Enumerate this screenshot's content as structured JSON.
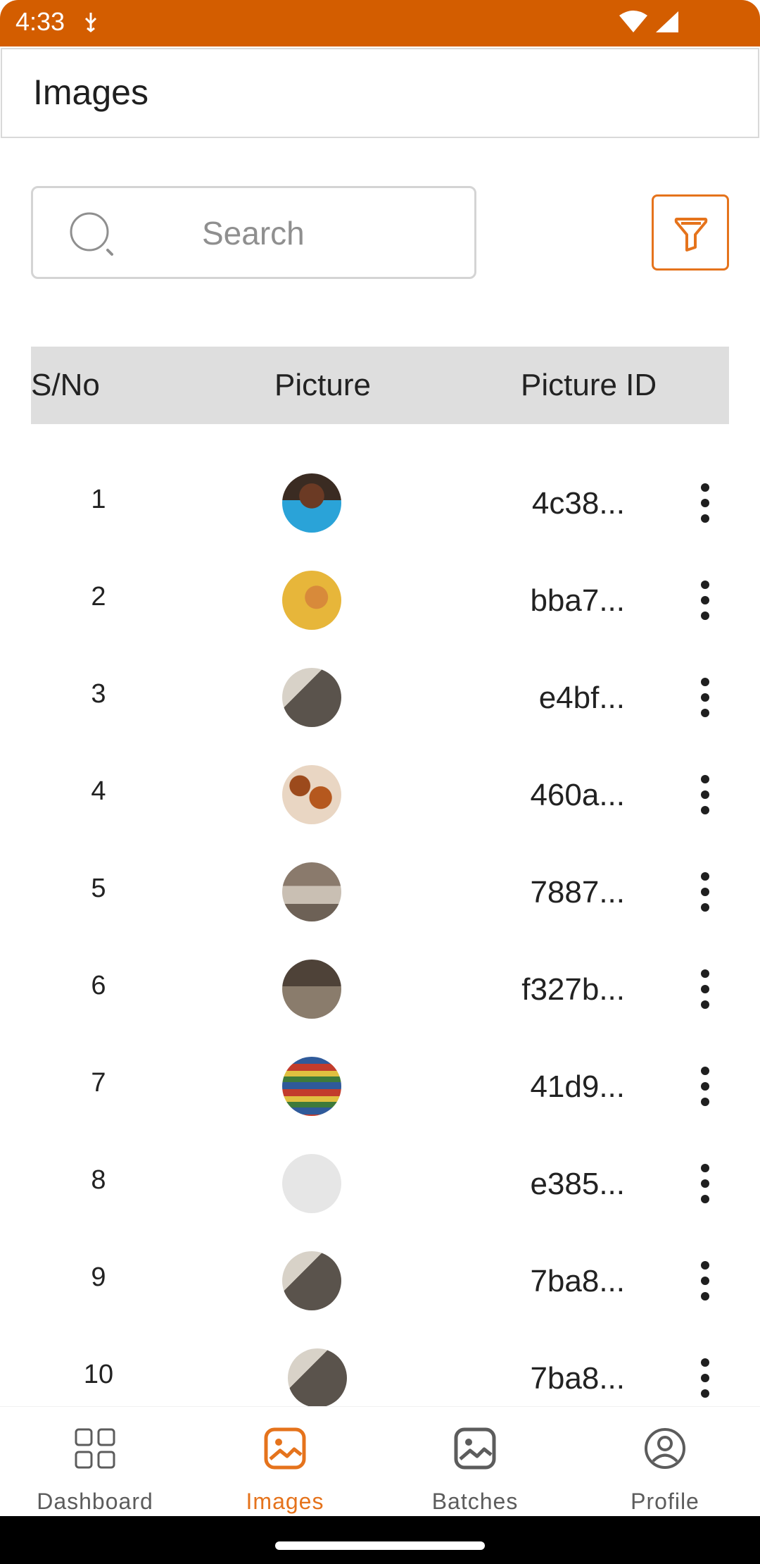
{
  "status": {
    "time": "4:33"
  },
  "header": {
    "title": "Images"
  },
  "search": {
    "placeholder": "Search"
  },
  "table": {
    "headers": [
      "S/No",
      "Picture",
      "Picture ID"
    ],
    "rows": [
      {
        "sno": "1",
        "id": "4c38...",
        "thumb": "child-portrait"
      },
      {
        "sno": "2",
        "id": "bba7...",
        "thumb": "cat"
      },
      {
        "sno": "3",
        "id": "e4bf...",
        "thumb": "room-checkerboard"
      },
      {
        "sno": "4",
        "id": "460a...",
        "thumb": "pretzels"
      },
      {
        "sno": "5",
        "id": "7887...",
        "thumb": "living-room"
      },
      {
        "sno": "6",
        "id": "f327b...",
        "thumb": "kitchen"
      },
      {
        "sno": "7",
        "id": "41d9...",
        "thumb": "store-shelves"
      },
      {
        "sno": "8",
        "id": "e385...",
        "thumb": "blank"
      },
      {
        "sno": "9",
        "id": "7ba8...",
        "thumb": "room-checkerboard"
      },
      {
        "sno": "10",
        "id": "7ba8...",
        "thumb": "room-checkerboard"
      }
    ]
  },
  "nav": {
    "items": [
      {
        "label": "Dashboard",
        "icon": "grid-icon",
        "active": false
      },
      {
        "label": "Images",
        "icon": "image-icon",
        "active": true
      },
      {
        "label": "Batches",
        "icon": "gallery-icon",
        "active": false
      },
      {
        "label": "Profile",
        "icon": "user-circle-icon",
        "active": false
      }
    ]
  },
  "colors": {
    "accent": "#e5731c",
    "statusbar": "#d35d00",
    "header_bg": "#dedede"
  }
}
